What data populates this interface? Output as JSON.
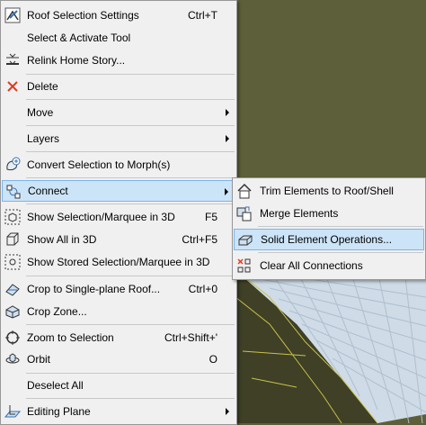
{
  "main_menu": {
    "items": [
      {
        "label": "Roof Selection Settings",
        "shortcut": "Ctrl+T"
      },
      {
        "label": "Select & Activate Tool",
        "shortcut": ""
      },
      {
        "label": "Relink Home Story...",
        "shortcut": ""
      },
      {
        "label": "Delete",
        "shortcut": ""
      },
      {
        "label": "Move",
        "shortcut": ""
      },
      {
        "label": "Layers",
        "shortcut": ""
      },
      {
        "label": "Convert Selection to Morph(s)",
        "shortcut": ""
      },
      {
        "label": "Connect",
        "shortcut": ""
      },
      {
        "label": "Show Selection/Marquee in 3D",
        "shortcut": "F5"
      },
      {
        "label": "Show All in 3D",
        "shortcut": "Ctrl+F5"
      },
      {
        "label": "Show Stored Selection/Marquee in 3D",
        "shortcut": ""
      },
      {
        "label": "Crop to Single-plane Roof...",
        "shortcut": "Ctrl+0"
      },
      {
        "label": "Crop Zone...",
        "shortcut": ""
      },
      {
        "label": "Zoom to Selection",
        "shortcut": "Ctrl+Shift+'"
      },
      {
        "label": "Orbit",
        "shortcut": "O"
      },
      {
        "label": "Deselect All",
        "shortcut": ""
      },
      {
        "label": "Editing Plane",
        "shortcut": ""
      }
    ]
  },
  "sub_menu": {
    "items": [
      {
        "label": "Trim Elements to Roof/Shell"
      },
      {
        "label": "Merge Elements"
      },
      {
        "label": "Solid Element Operations..."
      },
      {
        "label": "Clear All Connections"
      }
    ]
  },
  "colors": {
    "menu_bg": "#f0f0f0",
    "highlight_bg": "#cce4f7",
    "highlight_border": "#7eb4ea",
    "delete_icon": "#e03c1e"
  }
}
